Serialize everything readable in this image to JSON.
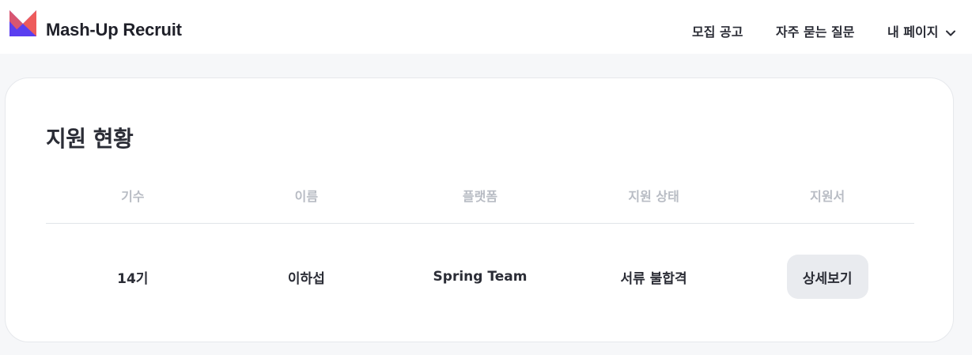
{
  "header": {
    "brand": "Mash-Up Recruit",
    "logo_icon": "mashup-logo-icon",
    "nav": [
      {
        "label": "모집 공고"
      },
      {
        "label": "자주 묻는 질문"
      },
      {
        "label": "내 페이지",
        "icon": "chevron-down-icon"
      }
    ]
  },
  "main": {
    "title": "지원 현황",
    "table": {
      "columns": [
        "기수",
        "이름",
        "플랫폼",
        "지원 상태",
        "지원서"
      ],
      "rows": [
        {
          "generation": "14기",
          "name": "이하섭",
          "platform": "Spring Team",
          "status": "서류 불합격",
          "action_label": "상세보기"
        }
      ]
    }
  },
  "colors": {
    "logo_blue": "#5a3ef0",
    "logo_red": "#ee5b5b",
    "page_background": "#f6f7f9",
    "header_text_muted": "#b8bcc4",
    "button_background": "#e9ebef"
  }
}
